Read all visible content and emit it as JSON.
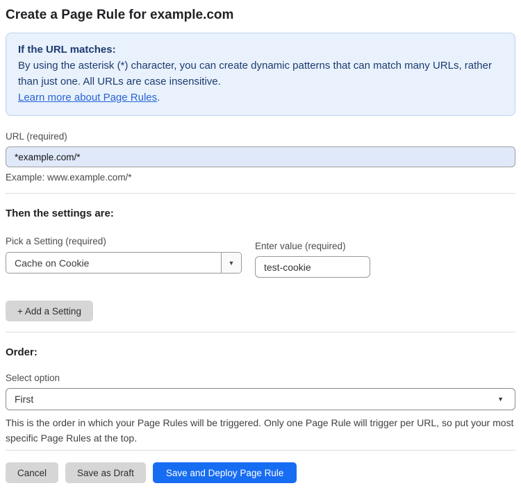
{
  "page": {
    "title": "Create a Page Rule for example.com"
  },
  "info_box": {
    "heading": "If the URL matches:",
    "body": "By using the asterisk (*) character, you can create dynamic patterns that can match many URLs, rather than just one. All URLs are case insensitive.",
    "link_label": "Learn more about Page Rules",
    "link_suffix": "."
  },
  "url_field": {
    "label": "URL (required)",
    "value": "*example.com/*",
    "helper": "Example: www.example.com/*"
  },
  "settings_section": {
    "heading": "Then the settings are:",
    "setting_picker": {
      "label": "Pick a Setting (required)",
      "selected": "Cache on Cookie"
    },
    "value_field": {
      "label": "Enter value (required)",
      "value": "test-cookie"
    },
    "add_setting_label": "+ Add a Setting"
  },
  "order_section": {
    "heading": "Order:",
    "select_label": "Select option",
    "selected_option": "First",
    "helper": "This is the order in which your Page Rules will be triggered. Only one Page Rule will trigger per URL, so put your most specific Page Rules at the top."
  },
  "footer": {
    "cancel_label": "Cancel",
    "save_draft_label": "Save as Draft",
    "save_deploy_label": "Save and Deploy Page Rule"
  },
  "icons": {
    "dropdown_arrow": "▼"
  },
  "colors": {
    "info_box_bg": "#e8f1fc",
    "info_box_border": "#bcd3ef",
    "info_text": "#1d3b6f",
    "link": "#2764d6",
    "url_input_bg": "#dfe9fa",
    "primary_button": "#176df2",
    "gray_button": "#d6d6d6"
  }
}
